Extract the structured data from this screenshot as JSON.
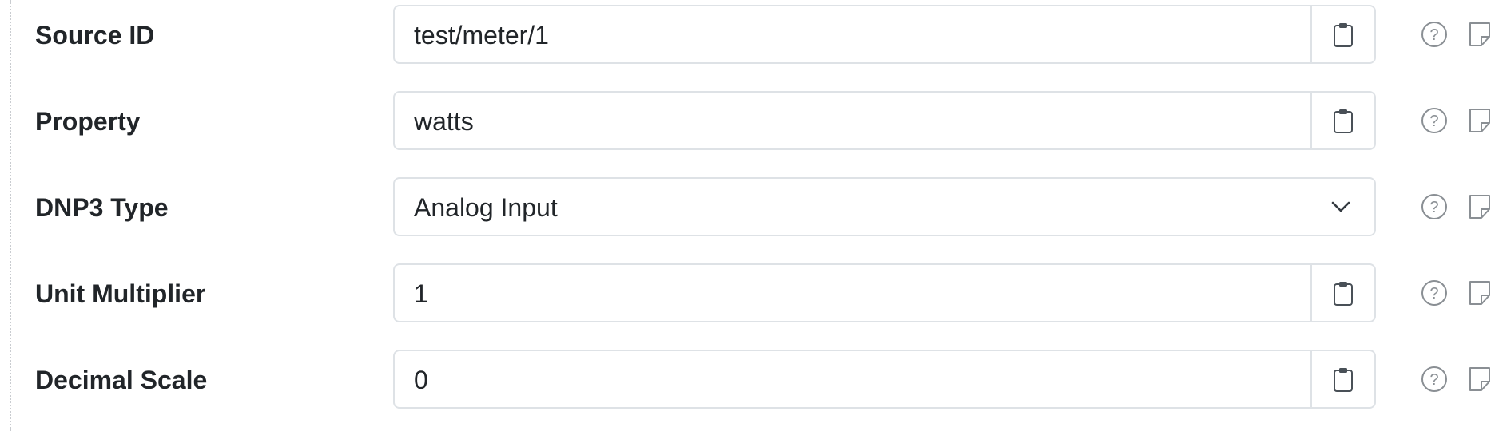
{
  "rows": [
    {
      "label": "Source ID",
      "value": "test/meter/1",
      "kind": "text"
    },
    {
      "label": "Property",
      "value": "watts",
      "kind": "text"
    },
    {
      "label": "DNP3 Type",
      "value": "Analog Input",
      "kind": "select"
    },
    {
      "label": "Unit Multiplier",
      "value": "1",
      "kind": "text"
    },
    {
      "label": "Decimal Scale",
      "value": "0",
      "kind": "text"
    }
  ],
  "icons": {
    "paste": "clipboard-icon",
    "help": "help-circle-icon",
    "note": "sticky-note-icon",
    "dropdown": "chevron-down-icon"
  },
  "colors": {
    "text": "#212529",
    "border": "#dee2e6",
    "icon": "#8a8f94"
  }
}
